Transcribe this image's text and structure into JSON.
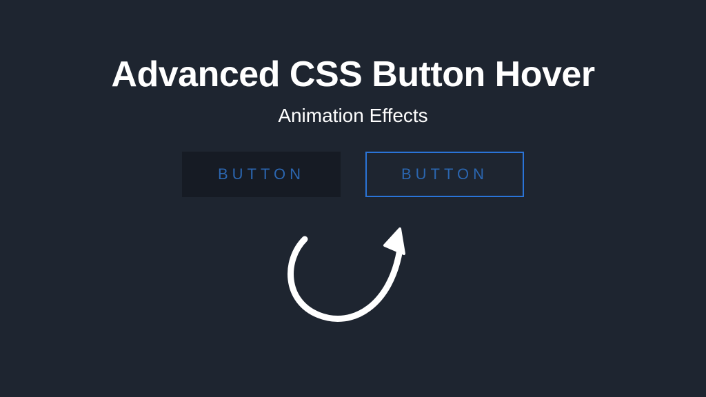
{
  "header": {
    "title": "Advanced CSS Button Hover",
    "subtitle": "Animation Effects"
  },
  "buttons": {
    "default_label": "BUTTON",
    "hover_label": "BUTTON"
  },
  "colors": {
    "background": "#1e2530",
    "button_default_bg": "#161b24",
    "button_text": "#2b66b0",
    "button_hover_border": "#2a74d8",
    "text_primary": "#ffffff",
    "arrow": "#ffffff"
  }
}
